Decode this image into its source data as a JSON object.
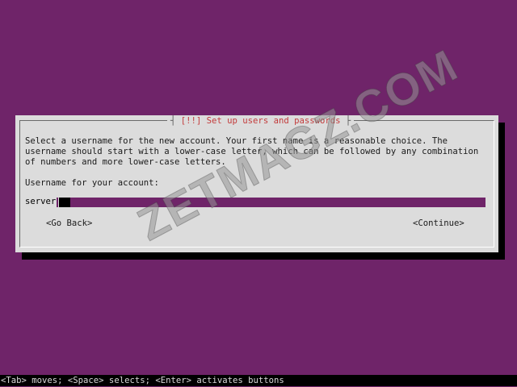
{
  "dialog": {
    "title": "[!!] Set up users and passwords",
    "prompt_lines": [
      "Select a username for the new account. Your first name is a reasonable choice. The",
      "username should start with a lower-case letter, which can be followed by any combination",
      "of numbers and more lower-case letters."
    ],
    "field_label": "Username for your account:",
    "input_value": "server",
    "buttons": {
      "back": "<Go Back>",
      "continue": "<Continue>"
    }
  },
  "statusbar": {
    "help": "<Tab> moves; <Space> selects; <Enter> activates buttons"
  },
  "watermark": "ZETMAGZ.COM",
  "colors": {
    "background": "#6f2469",
    "dialog": "#dcdcdc",
    "title": "#c33b3b",
    "statusbar": "#000000"
  }
}
